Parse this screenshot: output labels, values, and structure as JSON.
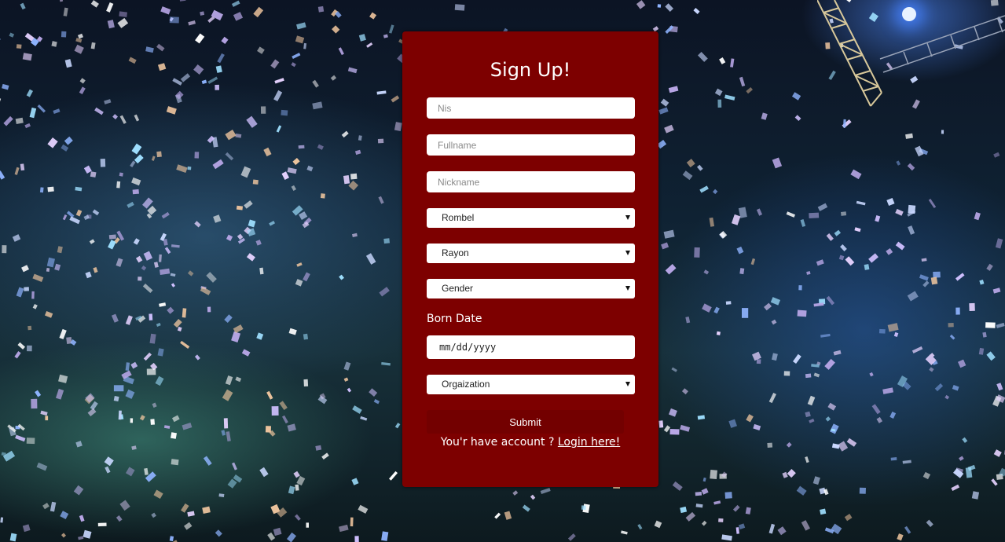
{
  "page": {
    "background": "concert-confetti-photo"
  },
  "colors": {
    "card": "#7d0000",
    "submit": "#730000",
    "text": "#ffffff"
  },
  "signup": {
    "title": "Sign Up!",
    "nis_placeholder": "Nis",
    "fullname_placeholder": "Fullname",
    "nickname_placeholder": "Nickname",
    "rombel_selected": "Rombel",
    "rayon_selected": "Rayon",
    "gender_selected": "Gender",
    "born_date_label": "Born Date",
    "born_date_value": "mm/dd/yyyy",
    "organization_selected": "Orgaization",
    "submit_label": "Submit",
    "footer_text": "You'r have account ?",
    "login_link": "Login here!"
  }
}
